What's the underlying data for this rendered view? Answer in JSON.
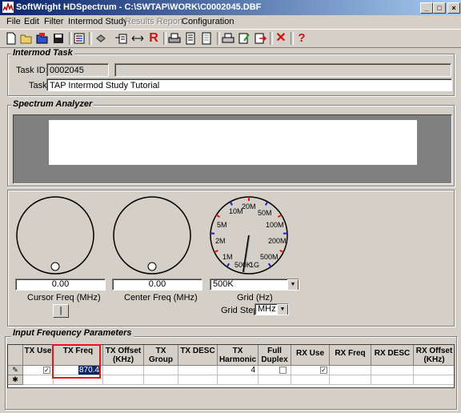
{
  "window": {
    "title": "SoftWright HDSpectrum - C:\\SWTAP\\WORK\\C0002045.DBF",
    "min_glyph": "_",
    "max_glyph": "□",
    "close_glyph": "×"
  },
  "menu": {
    "items": [
      "File",
      "Edit",
      "Filter",
      "Intermod Study",
      "Results Report",
      "Configuration"
    ]
  },
  "toolbar": {
    "icons": [
      "new-file-icon",
      "open-folder-icon",
      "open-blue-icon",
      "save-icon",
      "list-icon",
      "print-preview-icon",
      "import-icon",
      "resize-arrows-icon",
      "r-icon",
      "printer-doc-icon",
      "report-icon",
      "report2-icon",
      "printer-icon",
      "edit-doc-icon",
      "export-icon",
      "delete-x-icon",
      "help-icon"
    ],
    "r_glyph": "R",
    "delete_glyph": "✕",
    "help_glyph": "?"
  },
  "intermod_task": {
    "title": "Intermod Task",
    "task_id_label": "Task ID:",
    "task_id_value": "0002045",
    "task_label": "Task",
    "task_value": "TAP Intermod Study Tutorial"
  },
  "spectrum": {
    "title": "Spectrum Analyzer"
  },
  "controls": {
    "cursor_freq_value": "0.00",
    "cursor_freq_label": "Cursor Freq (MHz)",
    "center_freq_value": "0.00",
    "center_freq_label": "Center Freq (MHz)",
    "marker_button_label": "|",
    "grid_dial_labels": [
      "10M",
      "20M",
      "50M",
      "100M",
      "200M",
      "500M",
      "1G",
      "500K",
      "1M",
      "2M",
      "5M"
    ],
    "grid_value": "500K",
    "grid_label": "Grid (Hz)",
    "grid_step_label": "Grid Step",
    "grid_step_value": "MHz",
    "dropdown_glyph": "▼"
  },
  "input_params": {
    "title": "Input Frequency Parameters",
    "columns": [
      "TX Use",
      "TX Freq",
      "TX Offset (KHz)",
      "TX Group",
      "TX DESC",
      "TX Harmonic",
      "Full Duplex",
      "RX Use",
      "RX Freq",
      "RX DESC",
      "RX Offset (KHz)"
    ],
    "row1": {
      "tx_freq": "870.4",
      "tx_harmonic": "4"
    },
    "row_edit_glyph": "✎",
    "row_new_glyph": "✱",
    "check_glyph": "✓"
  },
  "colors": {
    "highlight_box": "#e8141a",
    "title_gradient_start": "#0a246a",
    "dial_tick": "#2020c0",
    "dial_tick_alt": "#e01818"
  }
}
